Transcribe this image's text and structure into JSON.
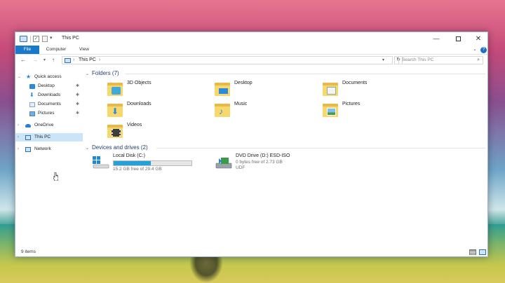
{
  "window": {
    "title": "This PC",
    "minimize_glyph": "—",
    "close_glyph": "✕"
  },
  "ribbon": {
    "tabs": [
      {
        "label": "File",
        "active": true
      },
      {
        "label": "Computer",
        "active": false
      },
      {
        "label": "View",
        "active": false
      }
    ]
  },
  "navbar": {
    "back_glyph": "←",
    "forward_glyph": "→",
    "up_glyph": "↑",
    "address": "This PC",
    "search_placeholder": "Search This PC"
  },
  "sidebar": {
    "items": [
      {
        "label": "Quick access",
        "icon": "star-icon",
        "pinned": false
      },
      {
        "label": "Desktop",
        "icon": "desktop-icon",
        "pinned": true
      },
      {
        "label": "Downloads",
        "icon": "download-icon",
        "pinned": true
      },
      {
        "label": "Documents",
        "icon": "documents-icon",
        "pinned": true
      },
      {
        "label": "Pictures",
        "icon": "pictures-icon",
        "pinned": true
      },
      {
        "label": "OneDrive",
        "icon": "onedrive-icon",
        "pinned": false
      },
      {
        "label": "This PC",
        "icon": "this-pc-icon",
        "selected": true
      },
      {
        "label": "Network",
        "icon": "network-icon",
        "pinned": false
      }
    ]
  },
  "content": {
    "folders_header": "Folders (7)",
    "folders": [
      {
        "label": "3D Objects",
        "icon": "3d-objects-folder-icon"
      },
      {
        "label": "Desktop",
        "icon": "desktop-folder-icon"
      },
      {
        "label": "Documents",
        "icon": "documents-folder-icon"
      },
      {
        "label": "Downloads",
        "icon": "downloads-folder-icon"
      },
      {
        "label": "Music",
        "icon": "music-folder-icon"
      },
      {
        "label": "Pictures",
        "icon": "pictures-folder-icon"
      },
      {
        "label": "Videos",
        "icon": "videos-folder-icon"
      }
    ],
    "drives_header": "Devices and drives (2)",
    "drives": [
      {
        "label": "Local Disk (C:)",
        "info": "15.2 GB free of 29.4 GB",
        "used_fraction": 0.48,
        "icon": "local-disk-icon"
      },
      {
        "label": "DVD Drive (D:) ESD-ISO",
        "info": "0 bytes free of 2.73 GB",
        "fs": "UDF",
        "icon": "dvd-drive-icon"
      }
    ]
  },
  "status": {
    "items_count": "9 items"
  },
  "colors": {
    "accent": "#1979ca",
    "selected_bg": "#cce4f7",
    "progress": "#26a0da",
    "folder": "#f7d86c"
  }
}
